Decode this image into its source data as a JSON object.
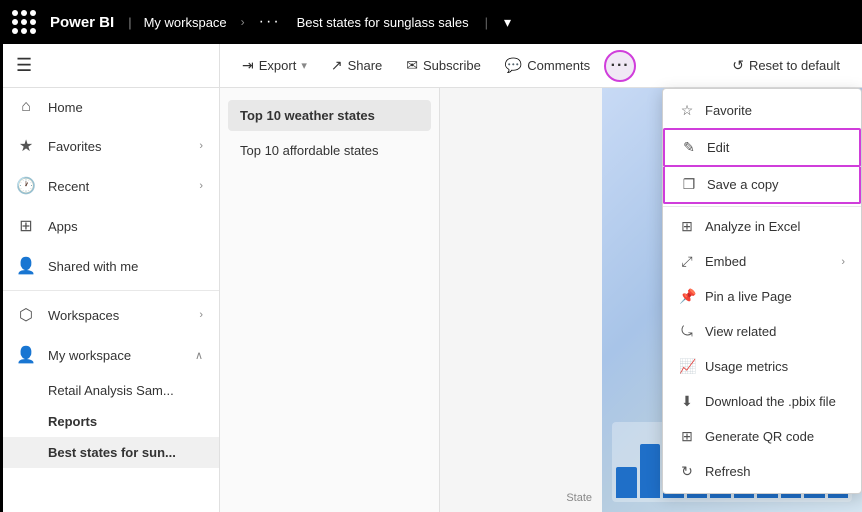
{
  "topbar": {
    "app_icon_label": "apps-icon",
    "brand": "Power BI",
    "workspace": "My workspace",
    "more_label": "···",
    "title": "Best states for sunglass sales",
    "pipe": "|",
    "dropdown_icon": "▾"
  },
  "sidebar": {
    "hamburger": "≡",
    "items": [
      {
        "id": "home",
        "icon": "⌂",
        "label": "Home",
        "chevron": false
      },
      {
        "id": "favorites",
        "icon": "★",
        "label": "Favorites",
        "chevron": true
      },
      {
        "id": "recent",
        "icon": "🕐",
        "label": "Recent",
        "chevron": true
      },
      {
        "id": "apps",
        "icon": "⊞",
        "label": "Apps",
        "chevron": false
      },
      {
        "id": "shared",
        "icon": "👤",
        "label": "Shared with me",
        "chevron": false
      },
      {
        "id": "workspaces",
        "icon": "⬡",
        "label": "Workspaces",
        "chevron": true
      },
      {
        "id": "myworkspace",
        "icon": "👤",
        "label": "My workspace",
        "chevron": "up"
      }
    ],
    "sub_items": [
      {
        "id": "retail",
        "label": "Retail Analysis Sam..."
      },
      {
        "id": "reports",
        "label": "Reports",
        "bold": true
      },
      {
        "id": "bestsales",
        "label": "Best states for sun...",
        "active": true
      }
    ]
  },
  "toolbar": {
    "export_label": "Export",
    "share_label": "Share",
    "subscribe_label": "Subscribe",
    "comments_label": "Comments",
    "more_label": "···",
    "reset_label": "Reset to default"
  },
  "pages": {
    "items": [
      {
        "id": "top10weather",
        "label": "Top 10 weather states",
        "active": true
      },
      {
        "id": "top10affordable",
        "label": "Top 10 affordable states"
      }
    ]
  },
  "dropdown": {
    "items": [
      {
        "id": "favorite",
        "icon": "☆",
        "label": "Favorite",
        "chevron": false,
        "highlighted": false
      },
      {
        "id": "edit",
        "icon": "✎",
        "label": "Edit",
        "chevron": false,
        "highlighted": true
      },
      {
        "id": "savecopy",
        "icon": "❐",
        "label": "Save a copy",
        "chevron": false,
        "highlighted": true
      },
      {
        "id": "analyze",
        "icon": "⊞",
        "label": "Analyze in Excel",
        "chevron": false,
        "highlighted": false
      },
      {
        "id": "embed",
        "icon": "⤢",
        "label": "Embed",
        "chevron": true,
        "highlighted": false
      },
      {
        "id": "pinlivepage",
        "icon": "📌",
        "label": "Pin a live Page",
        "chevron": false,
        "highlighted": false
      },
      {
        "id": "viewrelated",
        "icon": "⤿",
        "label": "View related",
        "chevron": false,
        "highlighted": false
      },
      {
        "id": "usagemetrics",
        "icon": "📈",
        "label": "Usage metrics",
        "chevron": false,
        "highlighted": false
      },
      {
        "id": "download",
        "icon": "⬇",
        "label": "Download the .pbix file",
        "chevron": false,
        "highlighted": false
      },
      {
        "id": "qrcode",
        "icon": "⊞",
        "label": "Generate QR code",
        "chevron": false,
        "highlighted": false
      },
      {
        "id": "refresh",
        "icon": "↻",
        "label": "Refresh",
        "chevron": false,
        "highlighted": false
      }
    ]
  },
  "barchart": {
    "bars": [
      40,
      70,
      55,
      85,
      60,
      75,
      50,
      90,
      65,
      80
    ]
  },
  "colors": {
    "highlight": "#d03ddb",
    "bar_blue": "#1f6fc8",
    "sidebar_active_bg": "#f0f0f0"
  }
}
